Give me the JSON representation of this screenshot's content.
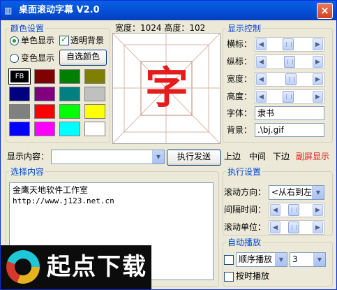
{
  "window": {
    "icon": "film-icon",
    "title": "桌面滚动字幕 V2.0",
    "close_label": "×"
  },
  "color_settings": {
    "title": "颜色设置",
    "single_color_label": "单色显示",
    "single_color_checked": true,
    "transparent_bg_label": "透明背景",
    "transparent_bg_checked": true,
    "gradient_color_label": "变色显示",
    "gradient_color_checked": false,
    "custom_color_button": "自选颜色",
    "swatches": [
      "#000000",
      "#800000",
      "#008000",
      "#808000",
      "#000080",
      "#800080",
      "#008080",
      "#c0c0c0",
      "#808080",
      "#ff0000",
      "#00ff00",
      "#ffff00",
      "#0000ff",
      "#ff00ff",
      "#00ffff",
      "#ffffff"
    ],
    "selected_swatch_label": "FB"
  },
  "preview": {
    "size_label": "宽度：1024 高度：102",
    "character": "字",
    "color": "#e51c1c"
  },
  "display_control": {
    "title": "显示控制",
    "horizontal_label": "横标：",
    "horizontal_value": 0.45,
    "vertical_label": "纵标：",
    "vertical_value": 0.5,
    "width_label": "宽度：",
    "width_value": 0.55,
    "height_label": "高度：",
    "height_value": 0.45,
    "font_label": "字体：",
    "font_value": "隶书",
    "background_label": "背景：",
    "background_value": ".\\bj.gif"
  },
  "display_row": {
    "label": "显示内容：",
    "content_value": "",
    "execute_button": "执行发送",
    "top_edge": "上边",
    "middle": "中间",
    "bottom_edge": "下边",
    "secondary_screen": "副屏显示",
    "secondary_color": "#e0201c"
  },
  "select_content": {
    "title": "选择内容",
    "lines": [
      "金鹰天地软件工作室",
      "http://www.j123.net.cn"
    ]
  },
  "execute_settings": {
    "title": "执行设置",
    "direction_label": "滚动方向：",
    "direction_value": "<从右到左>",
    "interval_label": "间隔时间：",
    "interval_value": 0.35,
    "unit_label": "滚动单位：",
    "unit_value": 0.35
  },
  "autoplay": {
    "title": "自动播放",
    "order_checked": false,
    "order_value": "顺序播放",
    "count_value": "3",
    "timed_label": "按时播放",
    "timed_checked": false
  },
  "watermark": {
    "text": "起点下载"
  }
}
